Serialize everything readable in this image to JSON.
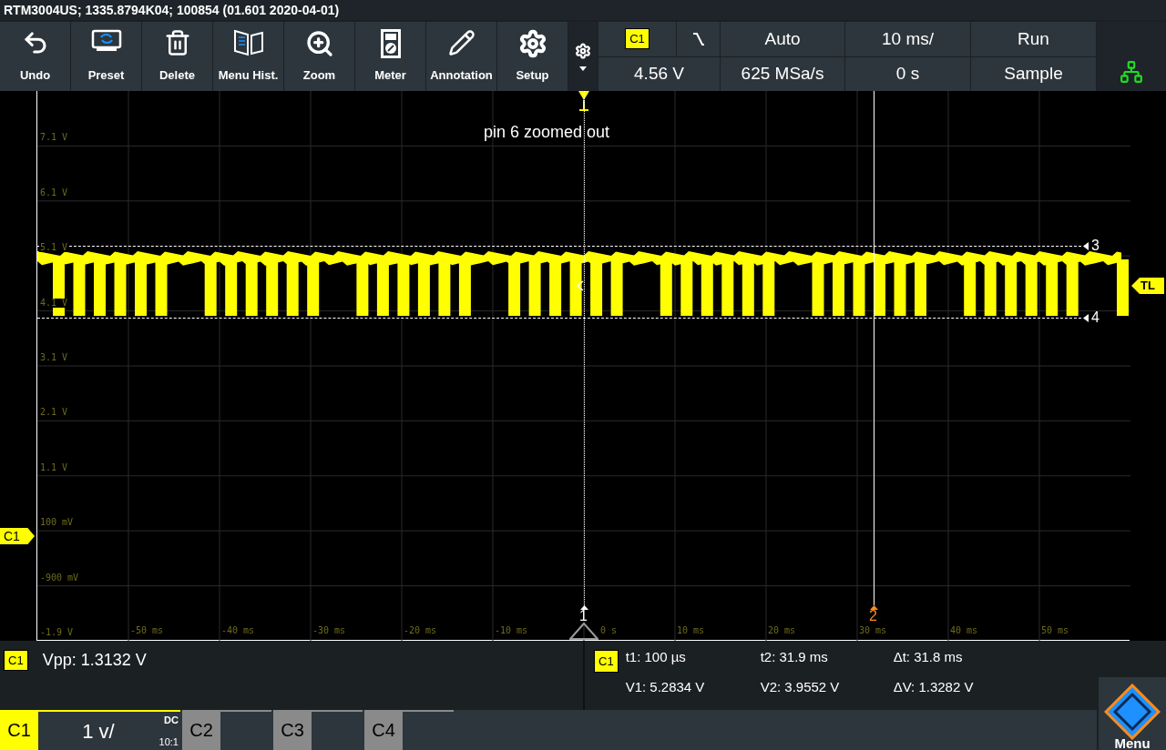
{
  "title_bar": "RTM3004US; 1335.8794K04; 100854 (01.601 2020-04-01)",
  "toolbar": [
    {
      "kind": "undo",
      "label": "Undo"
    },
    {
      "kind": "preset",
      "label": "Preset"
    },
    {
      "kind": "delete",
      "label": "Delete"
    },
    {
      "kind": "history",
      "label": "Menu Hist."
    },
    {
      "kind": "zoom",
      "label": "Zoom"
    },
    {
      "kind": "meter",
      "label": "Meter"
    },
    {
      "kind": "annotation",
      "label": "Annotation"
    },
    {
      "kind": "setup",
      "label": "Setup"
    }
  ],
  "trigger": {
    "source": "C1",
    "falling_edge": true,
    "mode": "Auto",
    "level": "4.56 V"
  },
  "acquisition": {
    "timebase": "10 ms/",
    "sample_rate": "625 MSa/s",
    "position": "0 s",
    "state": "Run",
    "mode": "Sample"
  },
  "display": {
    "y_labels": [
      "7.1 V",
      "6.1 V",
      "5.1 V",
      "4.1 V",
      "3.1 V",
      "2.1 V",
      "1.1 V",
      "100 mV",
      "-900 mV",
      "-1.9 V"
    ],
    "x_labels": [
      "-50 ms",
      "-40 ms",
      "-30 ms",
      "-20 ms",
      "-10 ms",
      "0 s",
      "10 ms",
      "20 ms",
      "30 ms",
      "40 ms",
      "50 ms"
    ],
    "annotation": "pin 6 zoomed out",
    "trigger_level_marker": "TL",
    "channel_marker": "C1",
    "cursors": [
      {
        "label": "1",
        "kind": "time",
        "color": "#ffffff"
      },
      {
        "label": "2",
        "kind": "time",
        "color": "#ff8c1a"
      },
      {
        "label": "3",
        "kind": "voltage",
        "color": "#ffffff"
      },
      {
        "label": "4",
        "kind": "voltage",
        "color": "#ffffff"
      }
    ]
  },
  "measurement": {
    "channel": "C1",
    "text": "Vpp: 1.3132 V"
  },
  "cursor_results": {
    "channel": "C1",
    "values": [
      "t1: 100 µs",
      "t2: 31.9 ms",
      "Δt: 31.8 ms",
      "V1: 5.2834 V",
      "V2: 3.9552 V",
      "ΔV: 1.3282 V"
    ]
  },
  "channels": [
    {
      "label": "C1",
      "selected": true,
      "scale": "1 v/",
      "coupling": "DC",
      "probe": "10:1"
    },
    {
      "label": "C2",
      "selected": false
    },
    {
      "label": "C3",
      "selected": false
    },
    {
      "label": "C4",
      "selected": false
    }
  ],
  "menu": "Menu"
}
